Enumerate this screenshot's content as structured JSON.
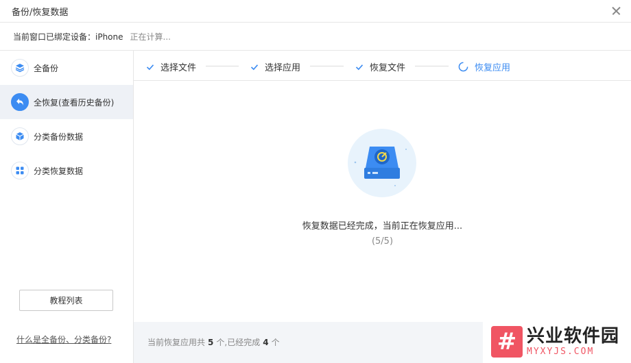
{
  "window": {
    "title": "备份/恢复数据"
  },
  "device": {
    "label": "当前窗口已绑定设备：iPhone",
    "status": "正在计算..."
  },
  "sidebar": {
    "items": [
      {
        "label": "全备份",
        "icon": "layers-icon",
        "active": false
      },
      {
        "label": "全恢复(查看历史备份)",
        "icon": "restore-arrow-icon",
        "active": true
      },
      {
        "label": "分类备份数据",
        "icon": "cube-icon",
        "active": false
      },
      {
        "label": "分类恢复数据",
        "icon": "grid-icon",
        "active": false
      }
    ],
    "tutorial_button": "教程列表",
    "help_link": "什么是全备份、分类备份?"
  },
  "steps": [
    {
      "label": "选择文件",
      "state": "done"
    },
    {
      "label": "选择应用",
      "state": "done"
    },
    {
      "label": "恢复文件",
      "state": "done"
    },
    {
      "label": "恢复应用",
      "state": "in-progress"
    }
  ],
  "status": {
    "message": "恢复数据已经完成，当前正在恢复应用...",
    "progress": "(5/5)"
  },
  "footer": {
    "prefix": "当前恢复应用共",
    "total": "5",
    "middle": "个,已经完成",
    "done": "4",
    "suffix": "个"
  },
  "watermark": {
    "logo": "#",
    "name": "兴业软件园",
    "domain": "MYXYJS.COM"
  },
  "colors": {
    "accent": "#3c8cf2",
    "watermark": "#f05563"
  }
}
